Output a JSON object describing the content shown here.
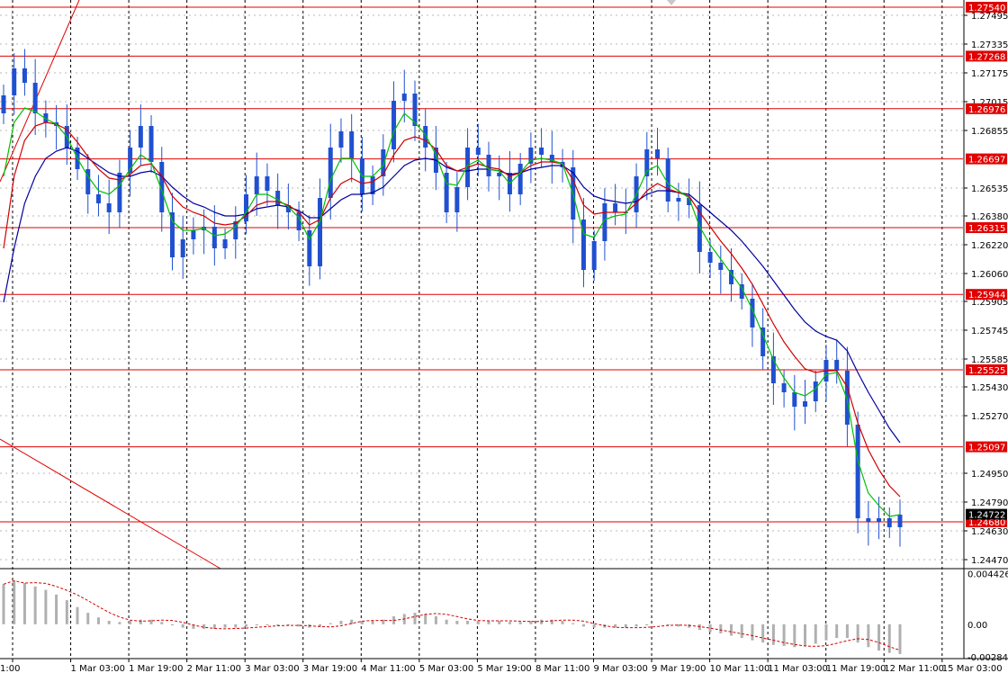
{
  "chart_data": {
    "type": "candlestick",
    "symbol_panel": "main",
    "x_tick_labels": [
      "1:00",
      "1 Mar 03:00",
      "1 Mar 19:00",
      "2 Mar 11:00",
      "3 Mar 03:00",
      "3 Mar 19:00",
      "4 Mar 11:00",
      "5 Mar 03:00",
      "5 Mar 19:00",
      "8 Mar 11:00",
      "9 Mar 03:00",
      "9 Mar 19:00",
      "10 Mar 11:00",
      "11 Mar 03:00",
      "11 Mar 19:00",
      "12 Mar 11:00",
      "15 Mar 03:00"
    ],
    "y_tick_labels": [
      "1.27495",
      "1.27335",
      "1.27175",
      "1.27015",
      "1.26855",
      "1.26535",
      "1.26380",
      "1.26220",
      "1.26060",
      "1.25905",
      "1.25745",
      "1.25585",
      "1.25430",
      "1.25270",
      "1.24950",
      "1.24790",
      "1.24630",
      "1.24470"
    ],
    "ylim": [
      1.2443,
      1.2758
    ],
    "horizontal_levels": [
      "1.27540",
      "1.27268",
      "1.26976",
      "1.26697",
      "1.26315",
      "1.25944",
      "1.25525",
      "1.25097",
      "1.24680"
    ],
    "current_price": "1.24722",
    "candles_close": [
      1.2705,
      1.272,
      1.2712,
      1.2695,
      1.269,
      1.2688,
      1.2676,
      1.2664,
      1.265,
      1.2645,
      1.264,
      1.2662,
      1.2676,
      1.2688,
      1.2668,
      1.264,
      1.2615,
      1.2625,
      1.263,
      1.2632,
      1.262,
      1.2625,
      1.2635,
      1.265,
      1.266,
      1.2652,
      1.2644,
      1.264,
      1.263,
      1.261,
      1.2648,
      1.2676,
      1.2685,
      1.267,
      1.265,
      1.266,
      1.2675,
      1.2702,
      1.2706,
      1.2688,
      1.2676,
      1.2662,
      1.264,
      1.2654,
      1.2676,
      1.2672,
      1.266,
      1.2662,
      1.265,
      1.2667,
      1.2676,
      1.2672,
      1.2668,
      1.2665,
      1.2636,
      1.2608,
      1.2624,
      1.2645,
      1.264,
      1.264,
      1.266,
      1.2675,
      1.267,
      1.2646,
      1.2648,
      1.2644,
      1.2618,
      1.2612,
      1.2608,
      1.26,
      1.2592,
      1.2576,
      1.256,
      1.2545,
      1.254,
      1.2532,
      1.2535,
      1.2546,
      1.2558,
      1.2552,
      1.2522,
      1.247,
      1.2468,
      1.247,
      1.2465,
      1.2472
    ],
    "ema_fast_green": [
      1.266,
      1.269,
      1.2698,
      1.2696,
      1.2692,
      1.2689,
      1.2682,
      1.267,
      1.266,
      1.2652,
      1.265,
      1.2655,
      1.2664,
      1.2672,
      1.2668,
      1.2652,
      1.2635,
      1.263,
      1.263,
      1.2631,
      1.2627,
      1.2628,
      1.2632,
      1.264,
      1.265,
      1.265,
      1.2647,
      1.2643,
      1.2637,
      1.2625,
      1.2635,
      1.2658,
      1.267,
      1.267,
      1.266,
      1.266,
      1.2666,
      1.2685,
      1.2695,
      1.269,
      1.2683,
      1.2672,
      1.2656,
      1.2655,
      1.2666,
      1.2669,
      1.2664,
      1.2663,
      1.2656,
      1.2662,
      1.2669,
      1.267,
      1.2669,
      1.2667,
      1.265,
      1.2628,
      1.2626,
      1.2636,
      1.2638,
      1.2639,
      1.265,
      1.2663,
      1.2666,
      1.2656,
      1.2652,
      1.2648,
      1.2632,
      1.2622,
      1.2614,
      1.2606,
      1.2598,
      1.2586,
      1.2572,
      1.2558,
      1.2548,
      1.254,
      1.2538,
      1.2542,
      1.255,
      1.2551,
      1.2536,
      1.2502,
      1.2484,
      1.2477,
      1.2471,
      1.2472
    ],
    "ema_mid_red": [
      1.262,
      1.266,
      1.268,
      1.2688,
      1.269,
      1.2689,
      1.2686,
      1.2679,
      1.2671,
      1.2664,
      1.2659,
      1.2658,
      1.2661,
      1.2666,
      1.2667,
      1.266,
      1.2649,
      1.2643,
      1.264,
      1.2638,
      1.2634,
      1.2633,
      1.2634,
      1.2638,
      1.2644,
      1.2646,
      1.2646,
      1.2644,
      1.264,
      1.2633,
      1.2636,
      1.2648,
      1.2656,
      1.2659,
      1.2656,
      1.2657,
      1.2661,
      1.2672,
      1.268,
      1.2682,
      1.268,
      1.2675,
      1.2666,
      1.2663,
      1.2665,
      1.2667,
      1.2665,
      1.2664,
      1.266,
      1.2662,
      1.2666,
      1.2668,
      1.2668,
      1.2667,
      1.2658,
      1.2644,
      1.2639,
      1.264,
      1.264,
      1.264,
      1.2645,
      1.2652,
      1.2656,
      1.2653,
      1.2651,
      1.2649,
      1.264,
      1.2632,
      1.2624,
      1.2617,
      1.2609,
      1.26,
      1.2589,
      1.2578,
      1.2568,
      1.256,
      1.2553,
      1.2551,
      1.2552,
      1.2552,
      1.2543,
      1.2523,
      1.2508,
      1.2497,
      1.2488,
      1.2482
    ],
    "ema_slow_blue": [
      1.259,
      1.262,
      1.2645,
      1.266,
      1.267,
      1.2674,
      1.2676,
      1.2674,
      1.267,
      1.2666,
      1.2662,
      1.266,
      1.266,
      1.2662,
      1.2663,
      1.266,
      1.2654,
      1.2649,
      1.2645,
      1.2643,
      1.264,
      1.2638,
      1.2638,
      1.2639,
      1.2642,
      1.2643,
      1.2644,
      1.2643,
      1.2641,
      1.2637,
      1.2637,
      1.2642,
      1.2647,
      1.265,
      1.265,
      1.2651,
      1.2654,
      1.266,
      1.2666,
      1.2669,
      1.267,
      1.2669,
      1.2665,
      1.2663,
      1.2663,
      1.2664,
      1.2664,
      1.2663,
      1.2661,
      1.2662,
      1.2664,
      1.2665,
      1.2666,
      1.2666,
      1.2662,
      1.2654,
      1.2649,
      1.2647,
      1.2646,
      1.2645,
      1.2646,
      1.265,
      1.2652,
      1.2652,
      1.2651,
      1.265,
      1.2645,
      1.264,
      1.2635,
      1.263,
      1.2624,
      1.2617,
      1.261,
      1.2602,
      1.2594,
      1.2586,
      1.2579,
      1.2574,
      1.2571,
      1.2569,
      1.2563,
      1.2551,
      1.254,
      1.253,
      1.252,
      1.2512
    ],
    "oscillator": {
      "y_tick_labels": [
        "0.004426",
        "0.00",
        "-0.002841"
      ],
      "ylim": [
        -0.003,
        0.0047
      ],
      "values": [
        0.0035,
        0.0038,
        0.0036,
        0.0033,
        0.003,
        0.0026,
        0.0021,
        0.0015,
        0.001,
        0.0006,
        0.0003,
        0.0002,
        0.0003,
        0.0004,
        0.0004,
        0.0002,
        -0.0001,
        -0.0003,
        -0.0004,
        -0.0004,
        -0.0004,
        -0.0003,
        -0.0003,
        -0.0002,
        -0.0001,
        -0.0001,
        -0.0001,
        -0.0001,
        -0.0002,
        -0.0003,
        -0.0002,
        0.0001,
        0.0003,
        0.0004,
        0.0003,
        0.0003,
        0.0004,
        0.0007,
        0.0009,
        0.001,
        0.0009,
        0.0007,
        0.0004,
        0.0003,
        0.0003,
        0.0003,
        0.0003,
        0.0003,
        0.0002,
        0.0002,
        0.0003,
        0.0004,
        0.0004,
        0.0003,
        0.0001,
        -0.0002,
        -0.0003,
        -0.0003,
        -0.0003,
        -0.0003,
        -0.0002,
        -0.0001,
        0.0,
        -0.0001,
        -0.0002,
        -0.0003,
        -0.0005,
        -0.0007,
        -0.0008,
        -0.001,
        -0.0012,
        -0.0014,
        -0.0016,
        -0.0018,
        -0.0019,
        -0.002,
        -0.0019,
        -0.0017,
        -0.0014,
        -0.0012,
        -0.0012,
        -0.0016,
        -0.002,
        -0.0023,
        -0.0025,
        -0.0026
      ]
    },
    "grid": true,
    "colors": {
      "candle": "#2050d0",
      "level_line": "#e00000",
      "level_tag": "#e00000",
      "ema_fast": "#00c000",
      "ema_mid": "#d00000",
      "ema_slow": "#0000a0",
      "current_tag": "#000000",
      "oscillator_hist": "#b0b0b0",
      "oscillator_signal": "#d00000"
    }
  }
}
